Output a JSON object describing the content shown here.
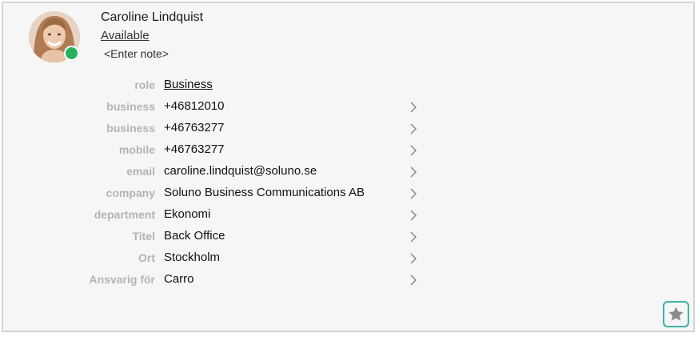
{
  "contact": {
    "name": "Caroline Lindquist",
    "presence": "Available",
    "note_placeholder": "<Enter note>",
    "presence_color": "#27b35c"
  },
  "fields": [
    {
      "label": "role",
      "value": "Business",
      "link": true,
      "chevron": false
    },
    {
      "label": "business",
      "value": "+46812010",
      "link": false,
      "chevron": true
    },
    {
      "label": "business",
      "value": "+46763277",
      "link": false,
      "chevron": true
    },
    {
      "label": "mobile",
      "value": "+46763277",
      "link": false,
      "chevron": true
    },
    {
      "label": "email",
      "value": "caroline.lindquist@soluno.se",
      "link": false,
      "chevron": true
    },
    {
      "label": "company",
      "value": "Soluno Business Communications AB",
      "link": false,
      "chevron": true
    },
    {
      "label": "department",
      "value": "Ekonomi",
      "link": false,
      "chevron": true
    },
    {
      "label": "Titel",
      "value": "Back Office",
      "link": false,
      "chevron": true
    },
    {
      "label": "Ort",
      "value": "Stockholm",
      "link": false,
      "chevron": true
    },
    {
      "label": "Ansvarig för",
      "value": "Carro",
      "link": false,
      "chevron": true
    }
  ],
  "icons": {
    "favorite": "star-icon",
    "row_action": "chevron-right-icon"
  },
  "colors": {
    "accent": "#3bb3a6",
    "label": "#b4b4b4",
    "star": "#8a8a8a"
  }
}
